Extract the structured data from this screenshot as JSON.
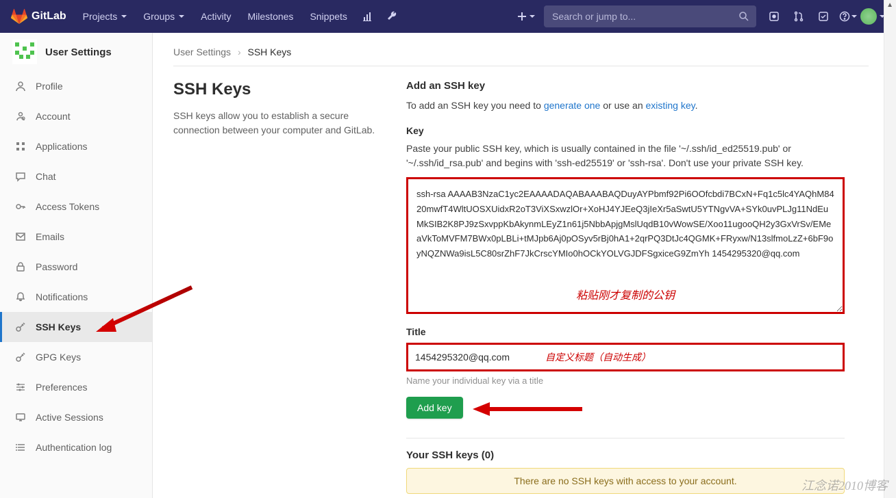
{
  "topbar": {
    "brand": "GitLab",
    "items": [
      "Projects",
      "Groups",
      "Activity",
      "Milestones",
      "Snippets"
    ],
    "search_placeholder": "Search or jump to..."
  },
  "sidebar": {
    "header": "User Settings",
    "items": [
      {
        "label": "Profile",
        "icon": "profile"
      },
      {
        "label": "Account",
        "icon": "account"
      },
      {
        "label": "Applications",
        "icon": "apps"
      },
      {
        "label": "Chat",
        "icon": "chat"
      },
      {
        "label": "Access Tokens",
        "icon": "token"
      },
      {
        "label": "Emails",
        "icon": "email"
      },
      {
        "label": "Password",
        "icon": "lock"
      },
      {
        "label": "Notifications",
        "icon": "bell"
      },
      {
        "label": "SSH Keys",
        "icon": "key",
        "active": true
      },
      {
        "label": "GPG Keys",
        "icon": "key"
      },
      {
        "label": "Preferences",
        "icon": "sliders"
      },
      {
        "label": "Active Sessions",
        "icon": "monitor"
      },
      {
        "label": "Authentication log",
        "icon": "list"
      }
    ]
  },
  "breadcrumb": {
    "a": "User Settings",
    "b": "SSH Keys"
  },
  "left": {
    "heading": "SSH Keys",
    "desc": "SSH keys allow you to establish a secure connection between your computer and GitLab."
  },
  "right": {
    "section_title": "Add an SSH key",
    "help_pre": "To add an SSH key you need to ",
    "help_link1": "generate one",
    "help_mid": " or use an ",
    "help_link2": "existing key",
    "key_label": "Key",
    "key_desc": "Paste your public SSH key, which is usually contained in the file '~/.ssh/id_ed25519.pub' or '~/.ssh/id_rsa.pub' and begins with 'ssh-ed25519' or 'ssh-rsa'. Don't use your private SSH key.",
    "key_value": "ssh-rsa AAAAB3NzaC1yc2EAAAADAQABAAABAQDuyAYPbmf92Pi6OOfcbdi7BCxN+Fq1c5lc4YAQhM8420mwfT4WltUOSXUidxR2oT3ViXSxwzlOr+XoHJ4YJEeQ3jIeXr5aSwtU5YTNgvVA+SYk0uvPLJg11NdEuMkSIB2K8PJ9zSxvppKbAkynmLEyZ1n61j5NbbApjgMslUqdB10vWowSE/Xoo11ugooQH2y3GxVrSv/EMeaVkToMVFM7BWx0pLBLi+tMJpb6Aj0pOSyv5rBj0hA1+2qrPQ3DtJc4QGMK+FRyxw/N13slfmoLzZ+6bF9oyNQZNWa9isL5C80srZhF7JkCrscYMIo0hOCkYOLVGJDFSgxiceG9ZmYh 1454295320@qq.com",
    "annotation_key": "粘贴刚才复制的公钥",
    "title_label": "Title",
    "title_value": "1454295320@qq.com",
    "annotation_title": "自定义标题（自动生成）",
    "title_hint": "Name your individual key via a title",
    "add_btn": "Add key",
    "your_keys": "Your SSH keys (0)",
    "notice": "There are no SSH keys with access to your account."
  },
  "watermark": "江念诺2010博客"
}
